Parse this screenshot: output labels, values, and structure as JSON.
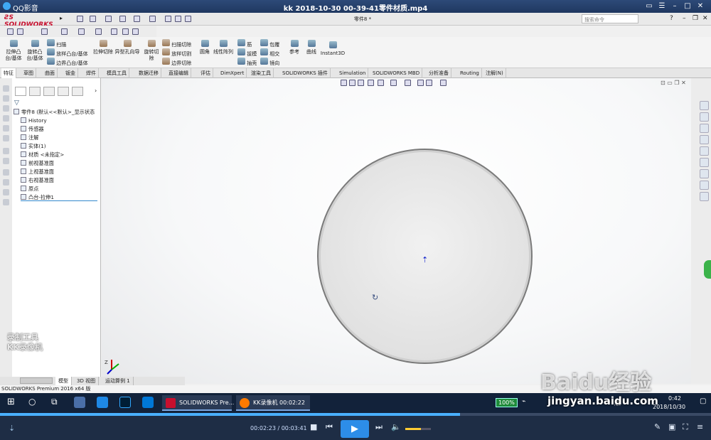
{
  "player": {
    "app_name": "QQ影音",
    "title": "kk 2018-10-30 00-39-41零件材质.mp4",
    "time_current": "00:02:23",
    "time_total": "00:03:41",
    "time_sep": " / ",
    "progress": 0.647,
    "volume": 0.6
  },
  "sw": {
    "brand": "SOLIDWORKS",
    "doc_title": "零件8 *",
    "search_placeholder": "搜索命令",
    "help": "?",
    "ribbon": {
      "large": [
        "拉伸凸台/基体",
        "旋转凸台/基体",
        "拉伸切除",
        "异型孔向导",
        "旋转切除",
        "圆角",
        "线性阵列",
        "参考",
        "曲线",
        "Instant3D"
      ],
      "small_col1": [
        "扫描",
        "放样凸台/基体",
        "边界凸台/基体"
      ],
      "small_col2": [
        "扫描切除",
        "放样切割",
        "边界切除"
      ],
      "small_col3": [
        "筋",
        "拔模",
        "抽壳"
      ],
      "small_col4": [
        "包覆",
        "相交",
        "镜向"
      ]
    },
    "tabs": [
      "特征",
      "草图",
      "曲面",
      "钣金",
      "焊件",
      "模具工具",
      "数据迁移",
      "直接编辑",
      "评估",
      "DimXpert",
      "渲染工具",
      "SOLIDWORKS 插件",
      "Simulation",
      "SOLIDWORKS MBD",
      "分析准备",
      "Routing",
      "注解(N)"
    ],
    "tree": {
      "root": "零件8 (默认<<默认>_显示状态",
      "items": [
        "History",
        "传感器",
        "注解",
        "实体(1)",
        "材质 <未指定>",
        "前视基准面",
        "上视基准面",
        "右视基准面",
        "原点",
        "凸台-拉伸1"
      ]
    },
    "bottom_tabs": [
      "模型",
      "3D 视图",
      "运动算例 1"
    ],
    "status": "SOLIDWORKS Premium 2016 x64 版",
    "triad": "Z"
  },
  "taskbar": {
    "tasks": [
      "SOLIDWORKS Pre...",
      "KK录像机 00:02:22"
    ],
    "battery": "100%",
    "clock_time": "0:42",
    "clock_date": "2018/10/30",
    "tray": "顺"
  },
  "watermarks": {
    "kk_line1": "录制工具",
    "kk_line2": "KK录像机",
    "baidu": "Baidu经验",
    "baidu_url": "jingyan.baidu.com"
  },
  "colors": {
    "title_bar": "#2d4a78",
    "taskbar": "#12223a",
    "player_bar": "#1e2d45",
    "progress": "#4ab0ff",
    "sw_red": "#c8102e"
  }
}
